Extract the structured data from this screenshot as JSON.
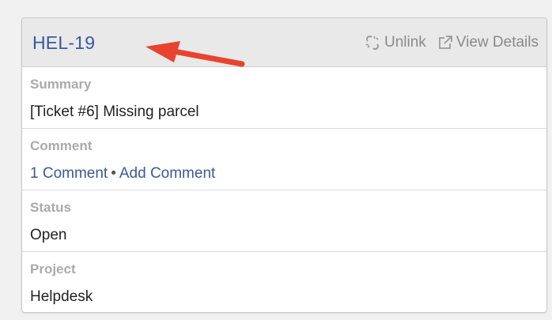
{
  "card": {
    "ticket_key": "HEL-19",
    "actions": {
      "unlink_label": "Unlink",
      "view_details_label": "View Details"
    }
  },
  "fields": {
    "summary": {
      "label": "Summary",
      "value": "[Ticket #6] Missing parcel"
    },
    "comment": {
      "label": "Comment",
      "comment_count_link": "1 Comment",
      "separator": "•",
      "add_comment_link": "Add Comment"
    },
    "status": {
      "label": "Status",
      "value": "Open"
    },
    "project": {
      "label": "Project",
      "value": "Helpdesk"
    }
  },
  "colors": {
    "link": "#3b5998",
    "label": "#aaaaaa",
    "header_bg": "#e9e9e9",
    "annotation_arrow": "#e8432e"
  },
  "icons": {
    "unlink": "unlink-icon",
    "view_details": "external-link-icon",
    "annotation": "red-arrow-icon"
  }
}
